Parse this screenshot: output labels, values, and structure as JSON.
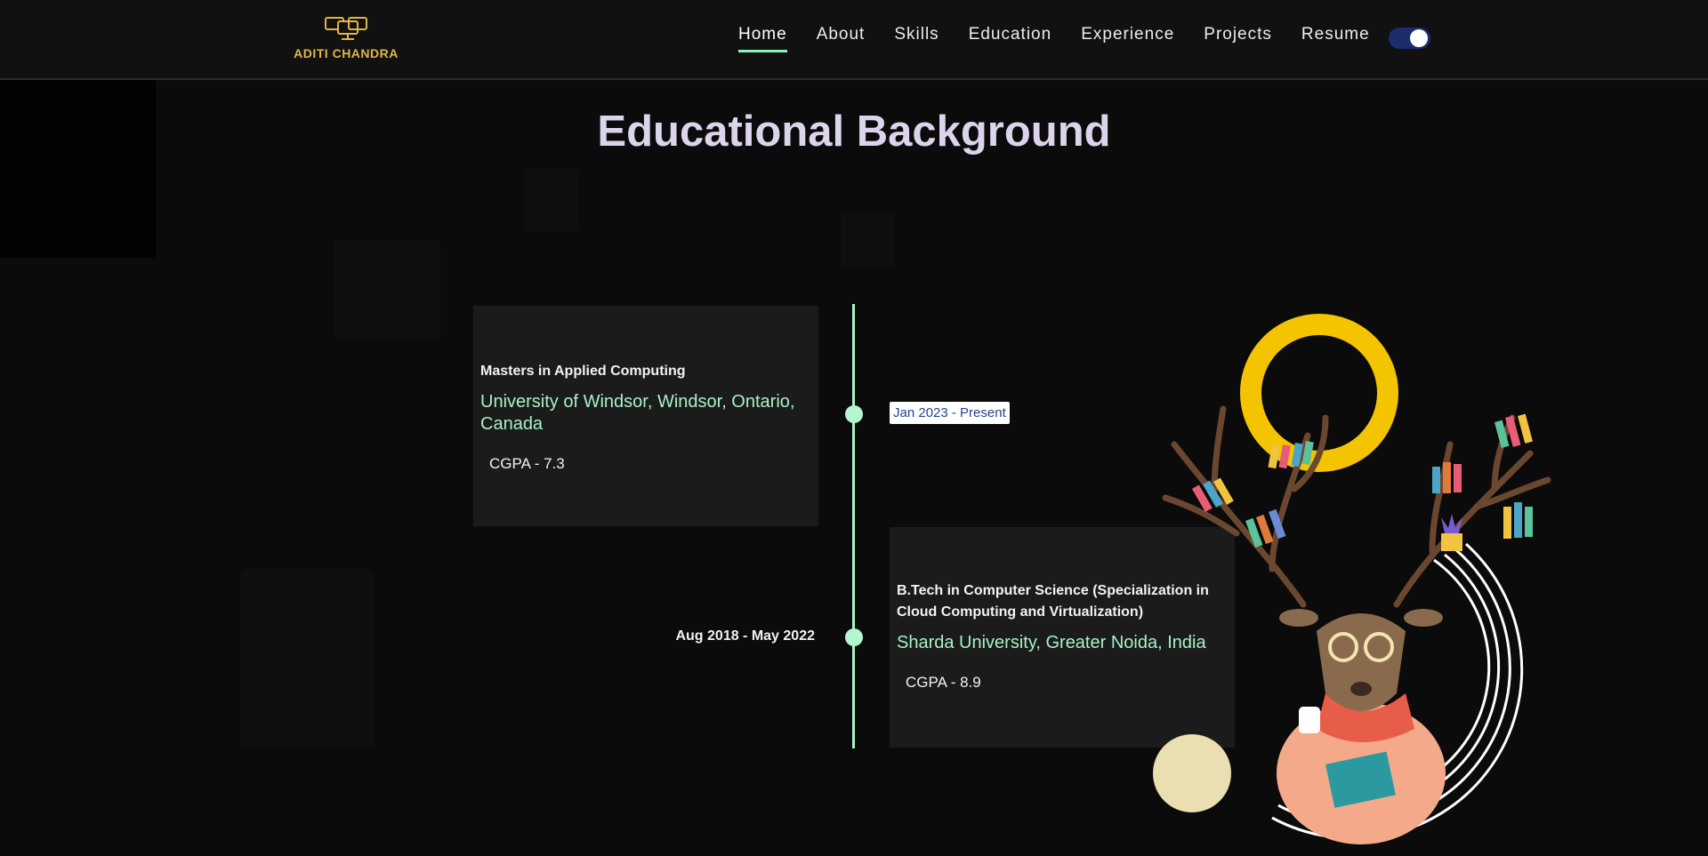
{
  "brand": {
    "name": "ADITI CHANDRA",
    "color": "#e0b54a"
  },
  "nav": {
    "links": [
      {
        "label": "Home",
        "active": true
      },
      {
        "label": "About"
      },
      {
        "label": "Skills"
      },
      {
        "label": "Education"
      },
      {
        "label": "Experience"
      },
      {
        "label": "Projects"
      },
      {
        "label": "Resume"
      }
    ],
    "theme_toggle": {
      "state": "on",
      "icon": "toggle-switch-icon"
    }
  },
  "education": {
    "title": "Educational Background",
    "entries": [
      {
        "degree": "Masters in Applied Computing",
        "school": "University of Windsor, Windsor, Ontario, Canada",
        "cgpa": "CGPA - 7.3",
        "date": "Jan 2023 - Present"
      },
      {
        "degree": "B.Tech in Computer Science (Specialization in Cloud Computing and Virtualization)",
        "school": "Sharda University, Greater Noida, India",
        "cgpa": "CGPA - 8.9",
        "date": "Aug 2018 - May 2022"
      }
    ]
  },
  "colors": {
    "accent": "#a7f1c8",
    "background": "#0b0b0b",
    "card": "#1b1b1b",
    "title": "#dcd4ec",
    "toggle": "#1d2c6b"
  }
}
